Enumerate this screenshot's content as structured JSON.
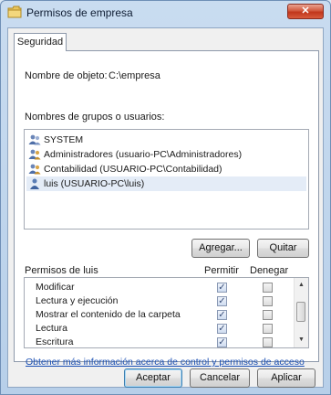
{
  "window": {
    "title": "Permisos de empresa",
    "close_label": "✕"
  },
  "tab": {
    "label": "Seguridad"
  },
  "object": {
    "label": "Nombre de objeto:",
    "value": "C:\\empresa"
  },
  "groups": {
    "label": "Nombres de grupos o usuarios:",
    "items": [
      {
        "label": "SYSTEM",
        "icon": "users-group-icon"
      },
      {
        "label": "Administradores (usuario-PC\\Administradores)",
        "icon": "users-group-icon"
      },
      {
        "label": "Contabilidad (USUARIO-PC\\Contabilidad)",
        "icon": "users-group-icon"
      },
      {
        "label": "luis (USUARIO-PC\\luis)",
        "icon": "user-icon",
        "selected": true
      }
    ]
  },
  "buttons": {
    "add": "Agregar...",
    "remove": "Quitar",
    "ok": "Aceptar",
    "cancel": "Cancelar",
    "apply": "Aplicar"
  },
  "permissions": {
    "label": "Permisos de luis",
    "allow_header": "Permitir",
    "deny_header": "Denegar",
    "rows": [
      {
        "name": "Modificar",
        "allow": true,
        "deny": false
      },
      {
        "name": "Lectura y ejecución",
        "allow": true,
        "deny": false
      },
      {
        "name": "Mostrar el contenido de la carpeta",
        "allow": true,
        "deny": false
      },
      {
        "name": "Lectura",
        "allow": true,
        "deny": false
      },
      {
        "name": "Escritura",
        "allow": true,
        "deny": false
      }
    ]
  },
  "link": {
    "label": "Obtener más información acerca de control y permisos de acceso"
  },
  "colors": {
    "link": "#1a4fb4",
    "close": "#c1361c",
    "selection": "#e4ecf7"
  }
}
